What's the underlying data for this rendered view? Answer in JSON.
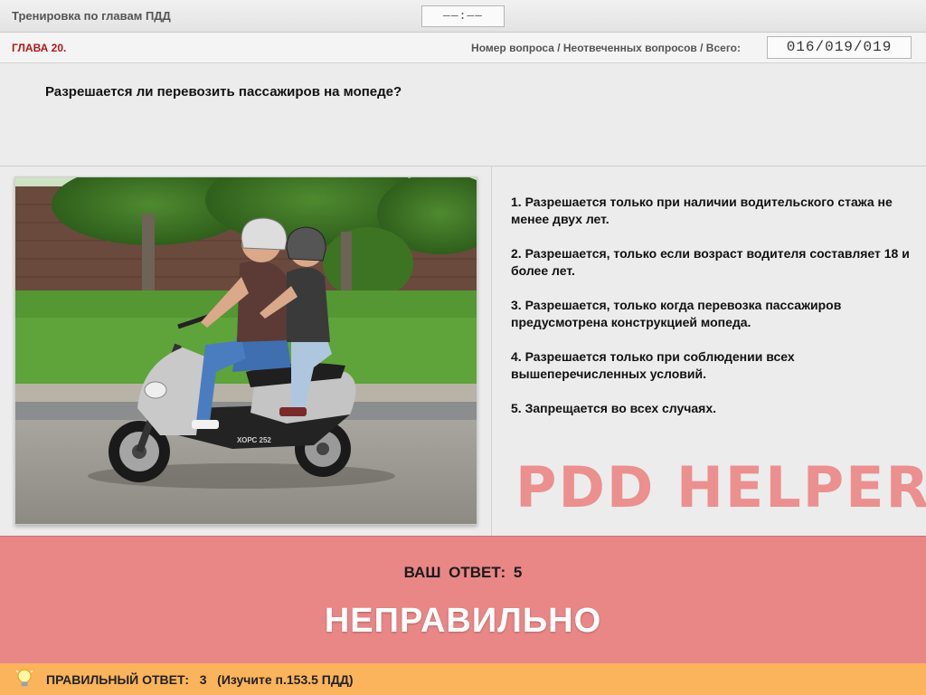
{
  "header": {
    "title": "Тренировка по главам ПДД",
    "timer": "––:––"
  },
  "chapter_bar": {
    "chapter": "ГЛАВА 20.",
    "counter_label": "Номер вопроса / Неотвеченных вопросов / Всего:",
    "counter_value": "016/019/019"
  },
  "question": {
    "text": "Разрешается ли перевозить пассажиров на мопеде?"
  },
  "answers": [
    {
      "label": "1.  Разрешается только при наличии водительского стажа не менее двух лет."
    },
    {
      "label": "2.  Разрешается, только если возраст водителя составляет 18 и более лет."
    },
    {
      "label": "3.  Разрешается, только когда перевозка пассажиров предусмотрена конструкцией мопеда."
    },
    {
      "label": "4.  Разрешается только при соблюдении всех вышеперечисленных условий."
    },
    {
      "label": "5.  Запрещается во всех случаях."
    }
  ],
  "watermark": "PDD HELPER",
  "photo": {
    "scooter_text": "ХОРС 252"
  },
  "result": {
    "your_answer": "ВАШ  ОТВЕТ:   5",
    "verdict": "НЕПРАВИЛЬНО"
  },
  "footer": {
    "correct_answer": "ПРАВИЛЬНЫЙ ОТВЕТ:   3   (Изучите п.153.5 ПДД)",
    "icon": "lightbulb-icon"
  },
  "colors": {
    "chapter_red": "#b01818",
    "result_bg": "#e98686",
    "watermark": "#ec8585",
    "footer_bg": "#fbb45c"
  }
}
